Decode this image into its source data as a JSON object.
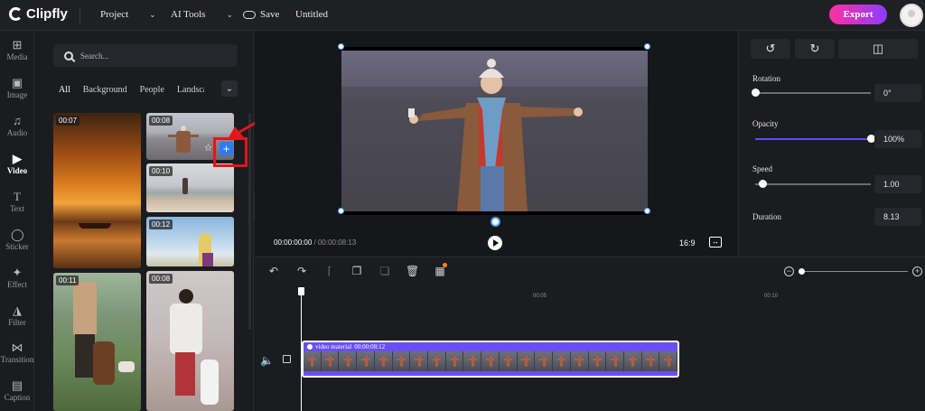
{
  "topbar": {
    "logo": "Clipfly",
    "project_menu": "Project",
    "ai_tools_menu": "AI Tools",
    "save_label": "Save",
    "doc_title": "Untitled",
    "export_label": "Export"
  },
  "rail": {
    "items": [
      {
        "label": "Media",
        "icon": "media-icon"
      },
      {
        "label": "Image",
        "icon": "image-icon"
      },
      {
        "label": "Audio",
        "icon": "music-note-icon"
      },
      {
        "label": "Video",
        "icon": "video-icon"
      },
      {
        "label": "Text",
        "icon": "text-icon"
      },
      {
        "label": "Sticker",
        "icon": "sticker-icon"
      },
      {
        "label": "Effect",
        "icon": "magic-wand-icon"
      },
      {
        "label": "Filter",
        "icon": "filter-icon"
      },
      {
        "label": "Transition",
        "icon": "transition-icon"
      },
      {
        "label": "Caption",
        "icon": "caption-icon"
      }
    ],
    "active": "Video"
  },
  "panel": {
    "search_placeholder": "Search...",
    "filters": [
      "All",
      "Background",
      "People",
      "Landscape"
    ],
    "thumbnails": [
      {
        "duration": "00:07",
        "scene": "sunset-boat"
      },
      {
        "duration": "00:08",
        "scene": "woman-field"
      },
      {
        "duration": "00:10",
        "scene": "beach-woman"
      },
      {
        "duration": "00:12",
        "scene": "sky-woman"
      },
      {
        "duration": "00:11",
        "scene": "dog-walk"
      },
      {
        "duration": "00:08",
        "scene": "woman-dalmatian"
      }
    ]
  },
  "preview": {
    "current_time": "00:00:00:00",
    "total_time": "00:00:08:13",
    "aspect_ratio": "16:9"
  },
  "properties": {
    "rotation_label": "Rotation",
    "rotation_value": "0°",
    "rotation_level": 0,
    "opacity_label": "Opacity",
    "opacity_value": "100%",
    "opacity_level": 1.0,
    "speed_label": "Speed",
    "speed_value": "1.00",
    "speed_level": 0.06,
    "duration_label": "Duration",
    "duration_value": "8.13"
  },
  "timeline": {
    "ticks": [
      "00:05",
      "00:10"
    ],
    "clip_label": "video material",
    "clip_duration": "00:00:08:12",
    "zoom_level": 0.0
  },
  "colors": {
    "accent": "#6a4ef5",
    "export_gradient_start": "#ff2fa0",
    "export_gradient_end": "#8c3cff",
    "annotation": "#e0171c",
    "selection": "#4aa2ff"
  }
}
